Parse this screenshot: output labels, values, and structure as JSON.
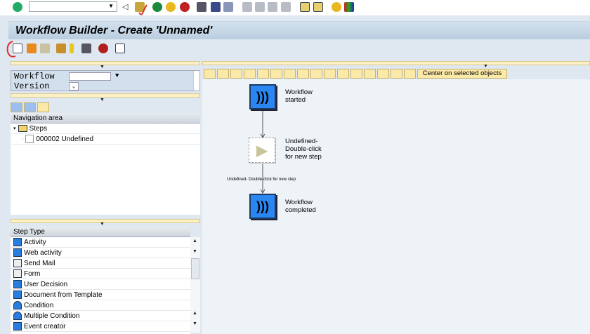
{
  "system_toolbar": {
    "command_field": "",
    "icons": [
      "enter-icon",
      "back-icon",
      "save-icon",
      "back-green-icon",
      "exit-icon",
      "cancel-icon",
      "print-icon",
      "find-icon",
      "find-next-icon",
      "first-page-icon",
      "prev-page-icon",
      "next-page-icon",
      "last-page-icon",
      "new-session-icon",
      "shortcut-icon",
      "help-icon",
      "customize-layout-icon"
    ]
  },
  "header": {
    "title": "Workflow Builder - Create 'Unnamed'"
  },
  "app_toolbar": {
    "icons": [
      "new-workflow-icon",
      "other-workflow-icon",
      "change-icon",
      "binding-icon",
      "check-icon",
      "print-graphic-icon",
      "test-icon",
      "layout-icon"
    ]
  },
  "left": {
    "form": {
      "workflow_label": "Workflow",
      "workflow_value": "",
      "version_label": "Version",
      "version_value": ""
    },
    "nav": {
      "header": "Navigation area",
      "tree": [
        {
          "label": "Steps"
        },
        {
          "label": "000002 Undefined"
        }
      ]
    },
    "step_types": {
      "header": "Step Type",
      "items": [
        "Activity",
        "Web activity",
        "Send Mail",
        "Form",
        "User Decision",
        "Document from Template",
        "Condition",
        "Multiple Condition",
        "Event creator"
      ]
    }
  },
  "graphic": {
    "toolbar": {
      "center_label": "Center on selected objects"
    },
    "nodes": {
      "start": "Workflow started",
      "undefined": "Undefined- Double-click for new step",
      "end": "Workflow completed"
    },
    "edge_label": "Undefined- Double-click for new step",
    "colors": {
      "event_node": "#2a86f0",
      "undefined_node": "#ffffff"
    }
  }
}
